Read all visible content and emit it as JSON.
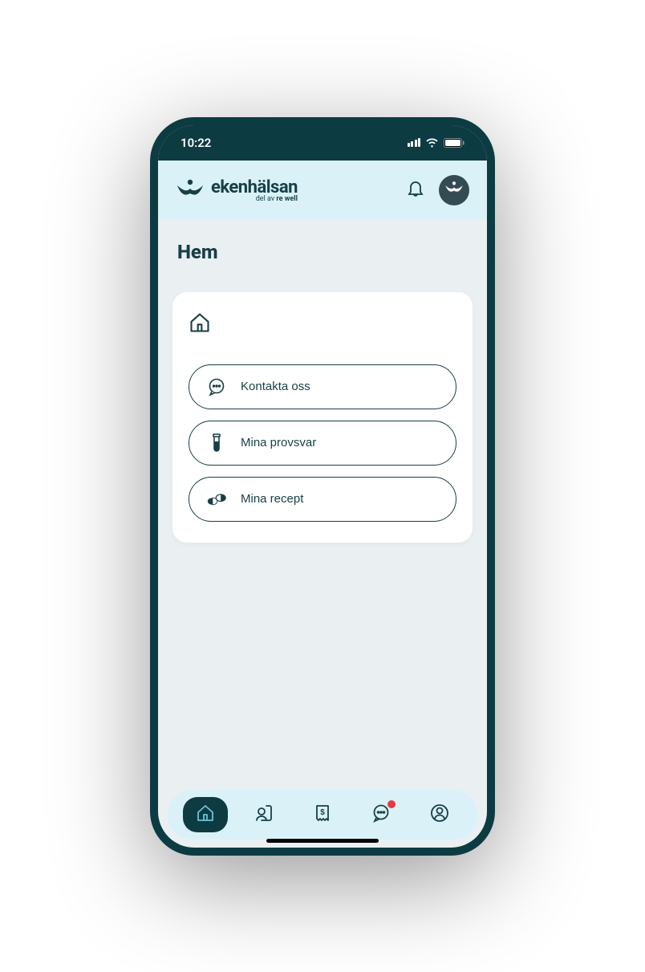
{
  "status": {
    "time": "10:22"
  },
  "brand": {
    "name": "ekenhälsan",
    "sub_prefix": "del av ",
    "sub_strong": "re well"
  },
  "page": {
    "title": "Hem"
  },
  "actions": [
    {
      "label": "Kontakta oss"
    },
    {
      "label": "Mina provsvar"
    },
    {
      "label": "Mina recept"
    }
  ]
}
